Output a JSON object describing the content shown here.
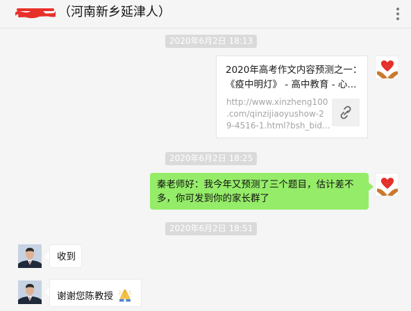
{
  "header": {
    "title": "（河南新乡延津人）"
  },
  "messages": {
    "ts1": "2020年6月2日 18:13",
    "card": {
      "title_line1": "2020年高考作文内容预测之一：",
      "title_line2": "《疫中明灯》 - 高中教育 - 心...",
      "url_line1": "http://www.xinzheng100",
      "url_line2": ".com/qinzijiaoyushow-2",
      "url_line3": "9-4516-1.html?bsh_bid..."
    },
    "ts2": "2020年6月2日 18:25",
    "sent_line1": "秦老师好：我今年又预测了三个题目，估计差不",
    "sent_line2": "多，你可发到你的家长群了",
    "ts3": "2020年6月2日 18:51",
    "reply1": "收到",
    "reply2": "谢谢您陈教授"
  },
  "colors": {
    "sent_bubble": "#95ec69",
    "received_bubble": "#ffffff",
    "background": "#f5f5f5"
  },
  "icons": [
    "menu-icon",
    "link-icon",
    "heart-hands-avatar",
    "person-avatar",
    "praying-hands-emoji"
  ]
}
